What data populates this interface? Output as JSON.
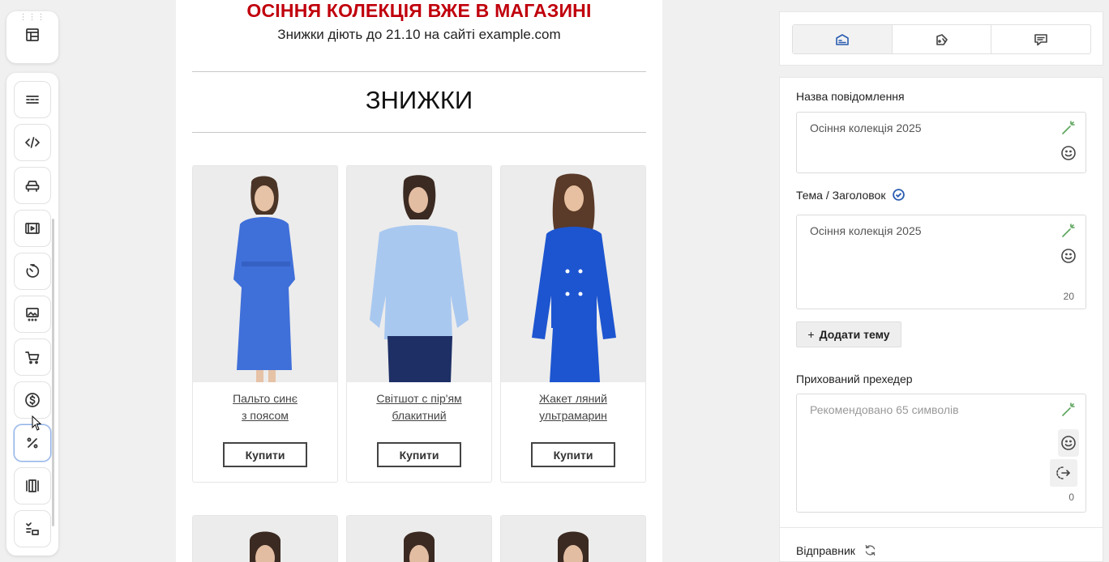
{
  "email": {
    "headline": "ОСІННЯ КОЛЕКЦІЯ ВЖЕ В МАГАЗИНІ",
    "subline": "Знижки діють до 21.10 на сайті example.com",
    "section_title": "ЗНИЖКИ",
    "products": [
      {
        "line1": "Пальто синє",
        "line2": "з поясом",
        "button": "Купити",
        "color": "#3f6fd9"
      },
      {
        "line1": "Світшот с пір'ям",
        "line2": "блакитний",
        "button": "Купити",
        "color": "#a9c8f0"
      },
      {
        "line1": "Жакет ляний",
        "line2": "ультрамарин",
        "button": "Купити",
        "color": "#1d55d0"
      }
    ]
  },
  "tools": [
    "divider-icon",
    "code-icon",
    "car-icon",
    "video-icon",
    "timer-icon",
    "image-gallery-icon",
    "cart-icon",
    "dollar-icon",
    "percent-icon",
    "carousel-icon",
    "list-icon"
  ],
  "settings": {
    "message_name_label": "Назва повідомлення",
    "message_name_value": "Осіння колекція 2025",
    "subject_label": "Тема / Заголовок",
    "subject_value": "Осіння колекція 2025",
    "subject_count": "20",
    "add_subject_label": "Додати тему",
    "preheader_label": "Прихований прехедер",
    "preheader_placeholder": "Рекомендовано 65 символів",
    "preheader_count": "0",
    "sender_label": "Відправник"
  },
  "colors": {
    "headline": "#c0000c",
    "accent": "#2a5db0",
    "wand": "#5aa35a"
  }
}
